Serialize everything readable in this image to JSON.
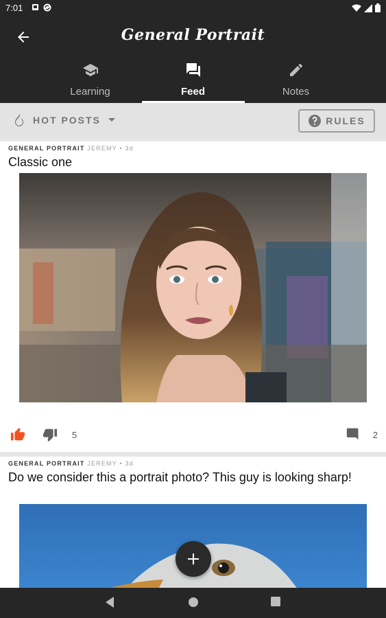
{
  "status_bar": {
    "time": "7:01"
  },
  "header": {
    "title": "General Portrait"
  },
  "tabs": [
    {
      "label": "Learning",
      "icon": "school-icon"
    },
    {
      "label": "Feed",
      "icon": "feed-icon",
      "active": true
    },
    {
      "label": "Notes",
      "icon": "pencil-icon"
    }
  ],
  "filter": {
    "sort_label": "HOT POSTS",
    "rules_label": "RULES"
  },
  "posts": [
    {
      "category": "GENERAL PORTRAIT",
      "author": "JEREMY • 3d",
      "title": "Classic one",
      "likes": "5",
      "comments": "2"
    },
    {
      "category": "GENERAL PORTRAIT",
      "author": "JEREMY • 3d",
      "title": "Do we consider this a portrait photo? This guy is looking sharp!"
    }
  ],
  "colors": {
    "accent": "#f4511e",
    "bar": "#262626"
  }
}
